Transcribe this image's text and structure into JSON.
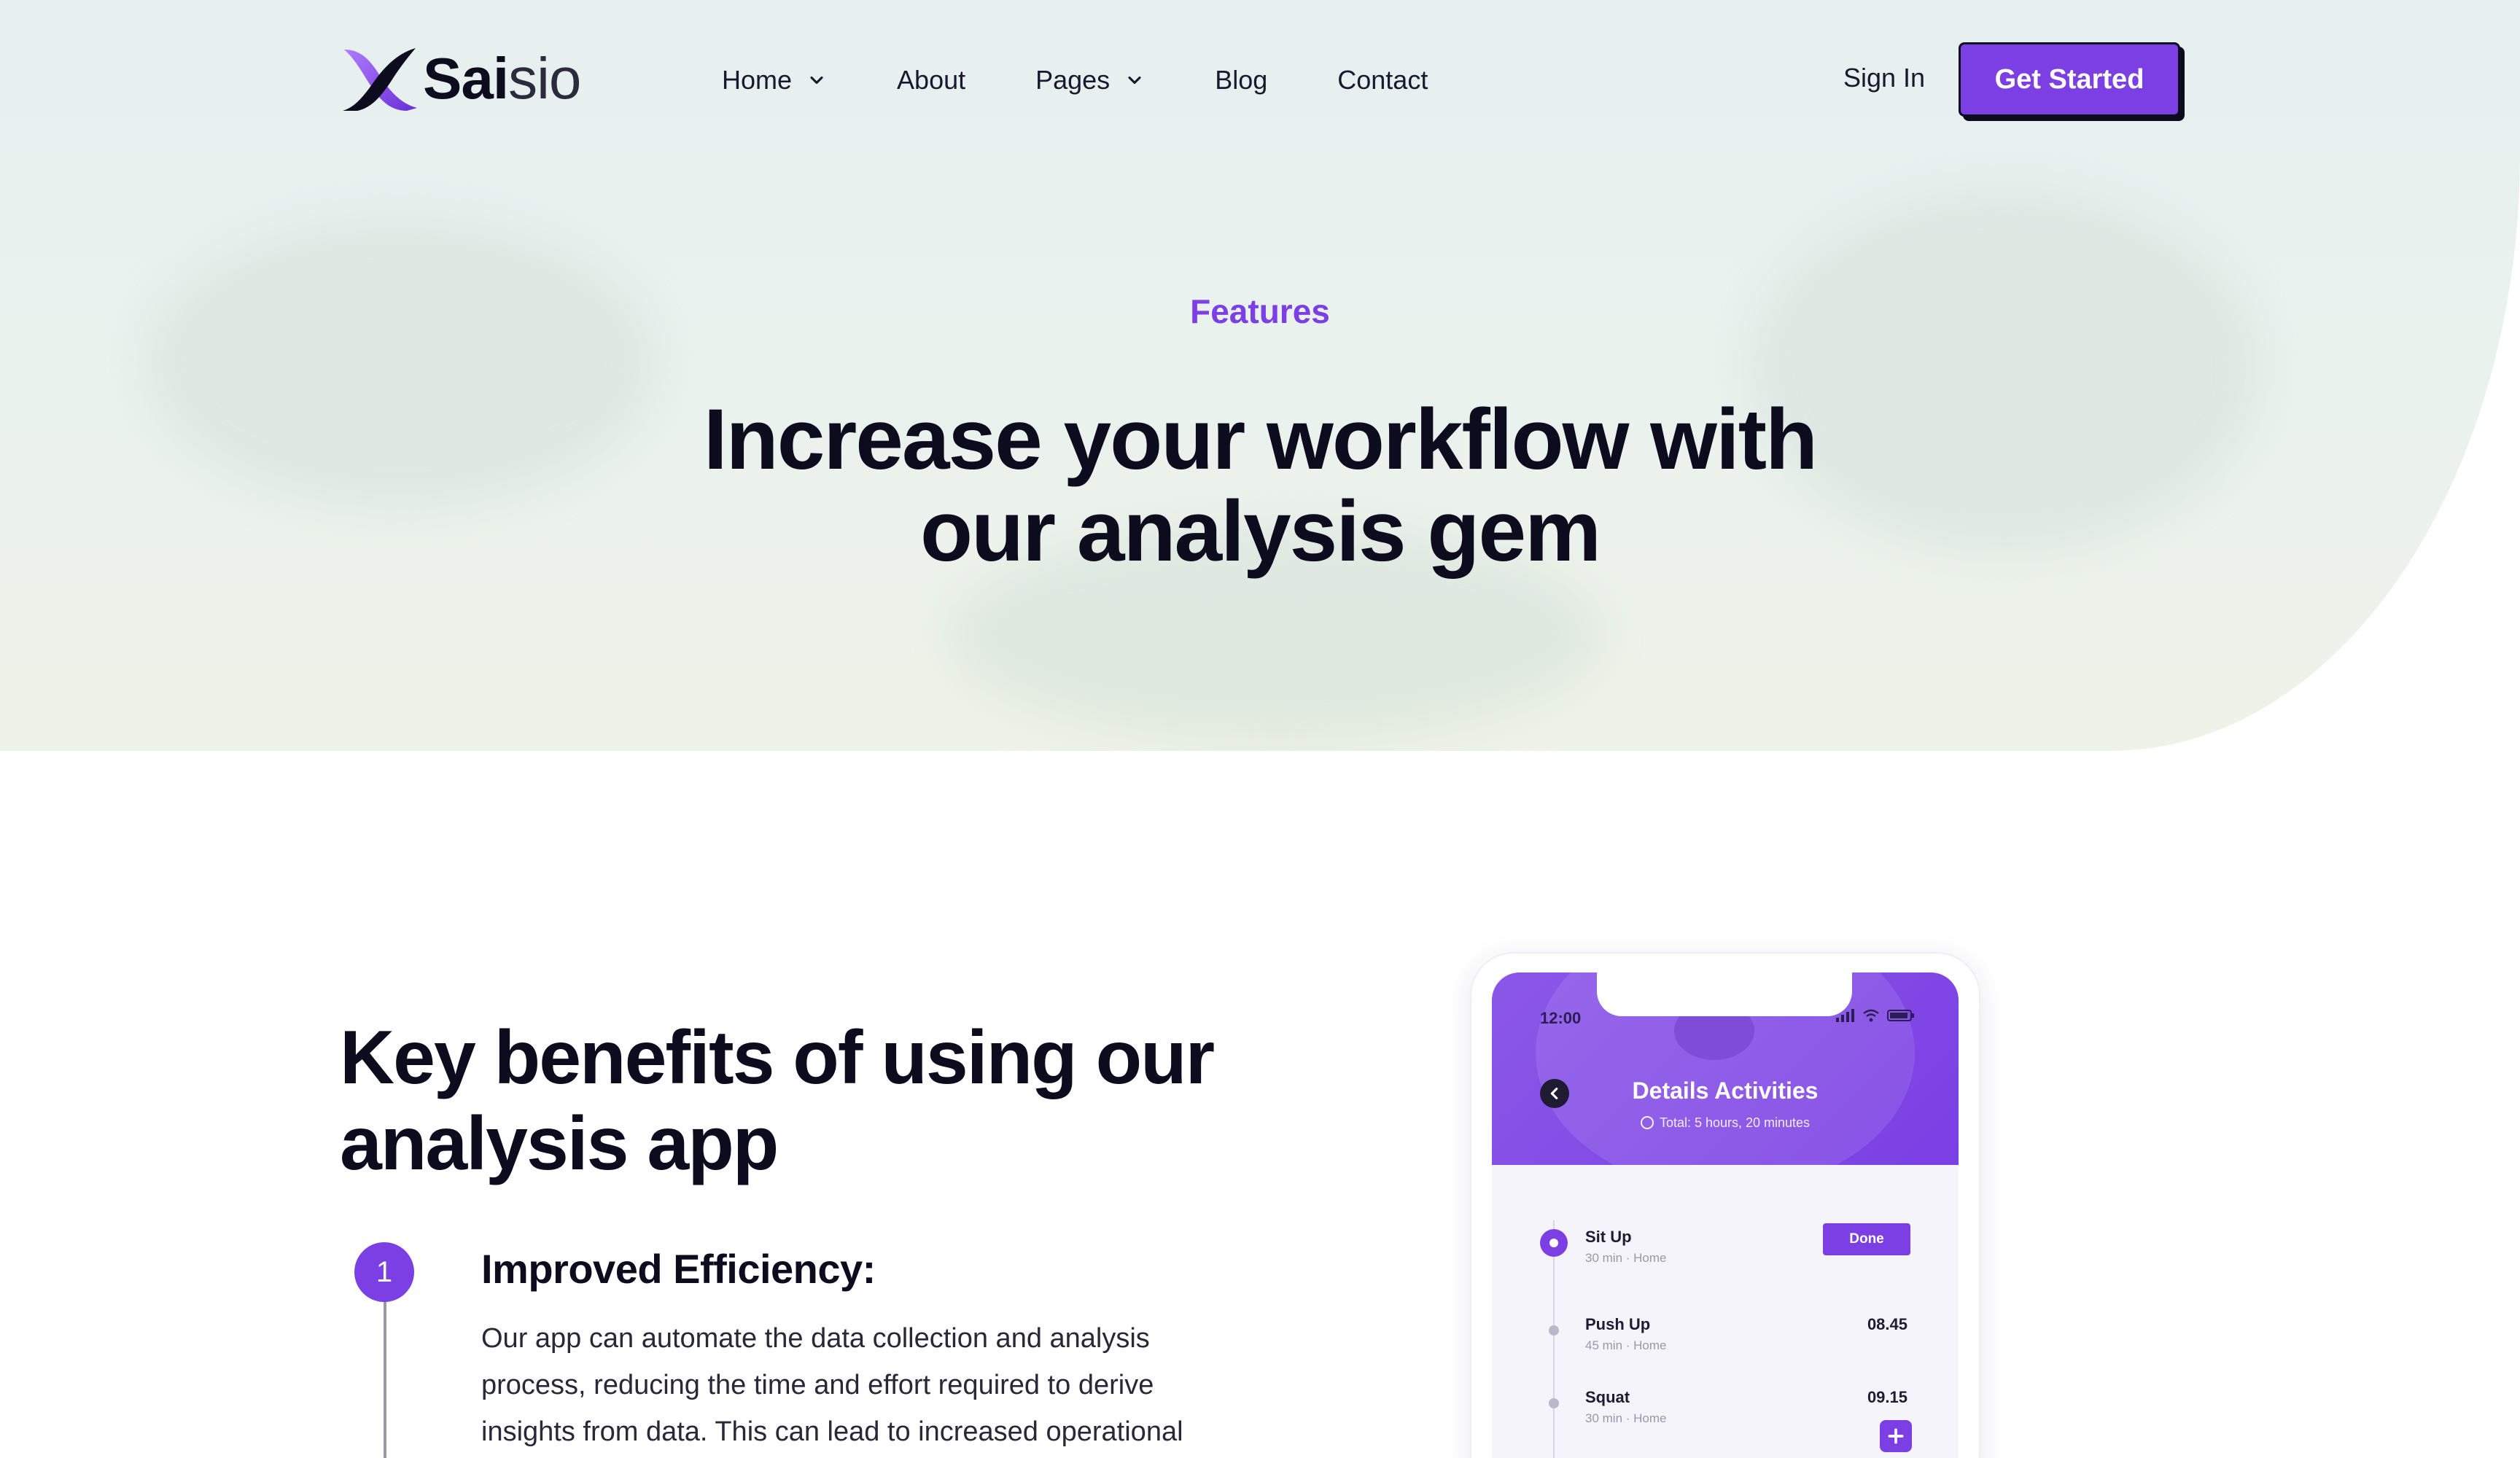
{
  "brand": {
    "name_bold": "Sai",
    "name_light": "sio",
    "colors": {
      "accent": "#7b3fe4",
      "dark": "#0d0b1e"
    }
  },
  "nav": {
    "items": [
      {
        "label": "Home",
        "has_dropdown": true
      },
      {
        "label": "About",
        "has_dropdown": false
      },
      {
        "label": "Pages",
        "has_dropdown": true
      },
      {
        "label": "Blog",
        "has_dropdown": false
      },
      {
        "label": "Contact",
        "has_dropdown": false
      }
    ],
    "sign_in": "Sign In",
    "cta": "Get Started"
  },
  "hero": {
    "eyebrow": "Features",
    "title_line1": "Increase your workflow with",
    "title_line2": "our analysis gem"
  },
  "benefits": {
    "title_line1": "Key benefits of using our",
    "title_line2": "analysis app",
    "steps": [
      {
        "number": "1",
        "title": "Improved Efficiency:",
        "text": "Our app can automate the data collection and analysis process, reducing the time and effort required to derive insights from data. This can lead to increased operational"
      }
    ]
  },
  "phone": {
    "time": "12:00",
    "title": "Details Activities",
    "subtitle": "Total: 5 hours, 20 minutes",
    "activities": [
      {
        "name": "Sit Up",
        "meta": "30 min · Home",
        "value": "",
        "action": "Done"
      },
      {
        "name": "Push Up",
        "meta": "45 min · Home",
        "value": "08.45",
        "action": ""
      },
      {
        "name": "Squat",
        "meta": "30 min · Home",
        "value": "09.15",
        "action": ""
      }
    ]
  }
}
